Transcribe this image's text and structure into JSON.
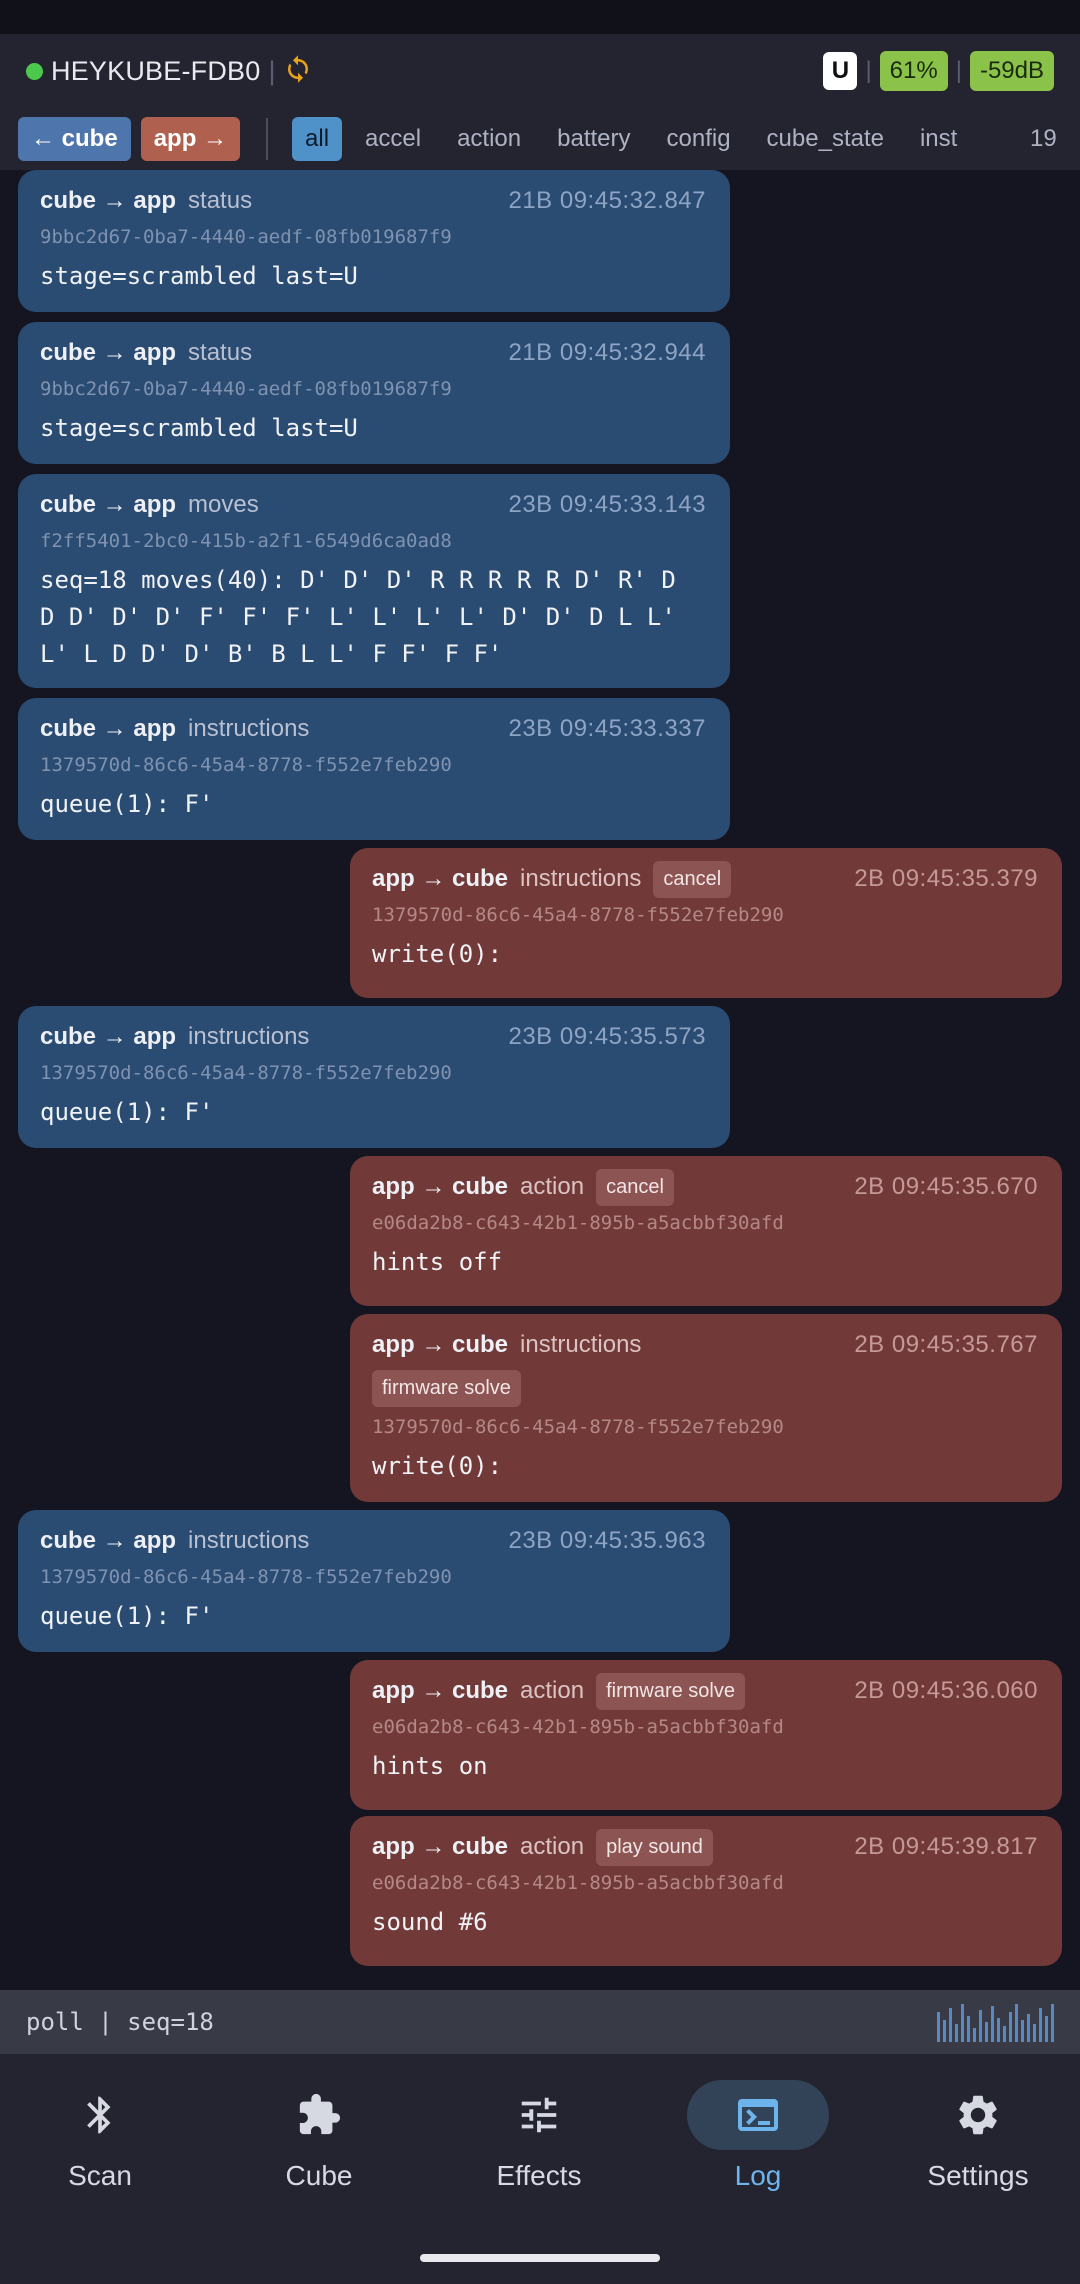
{
  "header": {
    "device_name": "HEYKUBE-FDB0",
    "separator": "|",
    "face": "U",
    "battery": "61%",
    "rssi": "-59dB",
    "status_color": "#4cc94c"
  },
  "filters": {
    "direction": [
      "← cube",
      "app →"
    ],
    "categories": [
      "all",
      "accel",
      "action",
      "battery",
      "config",
      "cube_state",
      "inst"
    ],
    "count": "19"
  },
  "messages": [
    {
      "dir": "cube → app",
      "type": "status",
      "size": "21B",
      "time": "09:45:32.847",
      "uuid": "9bbc2d67-0ba7-4440-aedf-08fb019687f9",
      "body": "stage=scrambled last=U"
    },
    {
      "dir": "cube → app",
      "type": "status",
      "size": "21B",
      "time": "09:45:32.944",
      "uuid": "9bbc2d67-0ba7-4440-aedf-08fb019687f9",
      "body": "stage=scrambled last=U"
    },
    {
      "dir": "cube → app",
      "type": "moves",
      "size": "23B",
      "time": "09:45:33.143",
      "uuid": "f2ff5401-2bc0-415b-a2f1-6549d6ca0ad8",
      "body_lines": [
        "seq=18 moves(40): D' D' D' R R R R R D' R' D",
        "D D' D' D' F' F' F' L' L' L' L' D' D' D L L'",
        "L' L D D' D' B' B L L' F F' F F'"
      ]
    },
    {
      "dir": "cube → app",
      "type": "instructions",
      "size": "23B",
      "time": "09:45:33.337",
      "uuid": "1379570d-86c6-45a4-8778-f552e7feb290",
      "body": "queue(1): F'"
    },
    {
      "dir": "app → cube",
      "type": "instructions",
      "tag": "cancel",
      "size": "2B",
      "time": "09:45:35.379",
      "uuid": "1379570d-86c6-45a4-8778-f552e7feb290",
      "body": "write(0):"
    },
    {
      "dir": "cube → app",
      "type": "instructions",
      "size": "23B",
      "time": "09:45:35.573",
      "uuid": "1379570d-86c6-45a4-8778-f552e7feb290",
      "body": "queue(1): F'"
    },
    {
      "dir": "app → cube",
      "type": "action",
      "tag": "cancel",
      "size": "2B",
      "time": "09:45:35.670",
      "uuid": "e06da2b8-c643-42b1-895b-a5acbbf30afd",
      "body": "hints off"
    },
    {
      "dir": "app → cube",
      "type": "instructions",
      "tag": "firmware solve",
      "size": "2B",
      "time": "09:45:35.767",
      "uuid": "1379570d-86c6-45a4-8778-f552e7feb290",
      "body": "write(0):"
    },
    {
      "dir": "cube → app",
      "type": "instructions",
      "size": "23B",
      "time": "09:45:35.963",
      "uuid": "1379570d-86c6-45a4-8778-f552e7feb290",
      "body": "queue(1): F'"
    },
    {
      "dir": "app → cube",
      "type": "action",
      "tag": "firmware solve",
      "size": "2B",
      "time": "09:45:36.060",
      "uuid": "e06da2b8-c643-42b1-895b-a5acbbf30afd",
      "body": "hints on"
    },
    {
      "dir": "app → cube",
      "type": "action",
      "tag": "play sound",
      "size": "2B",
      "time": "09:45:39.817",
      "uuid": "e06da2b8-c643-42b1-895b-a5acbbf30afd",
      "body": "sound #6"
    }
  ],
  "footer": {
    "text": "poll | seq=18"
  },
  "nav": {
    "scan": "Scan",
    "cube": "Cube",
    "effects": "Effects",
    "log": "Log",
    "settings": "Settings"
  },
  "colors": {
    "incoming": "#2a4b72",
    "outgoing": "#713a39",
    "accent": "#6db4ec"
  }
}
